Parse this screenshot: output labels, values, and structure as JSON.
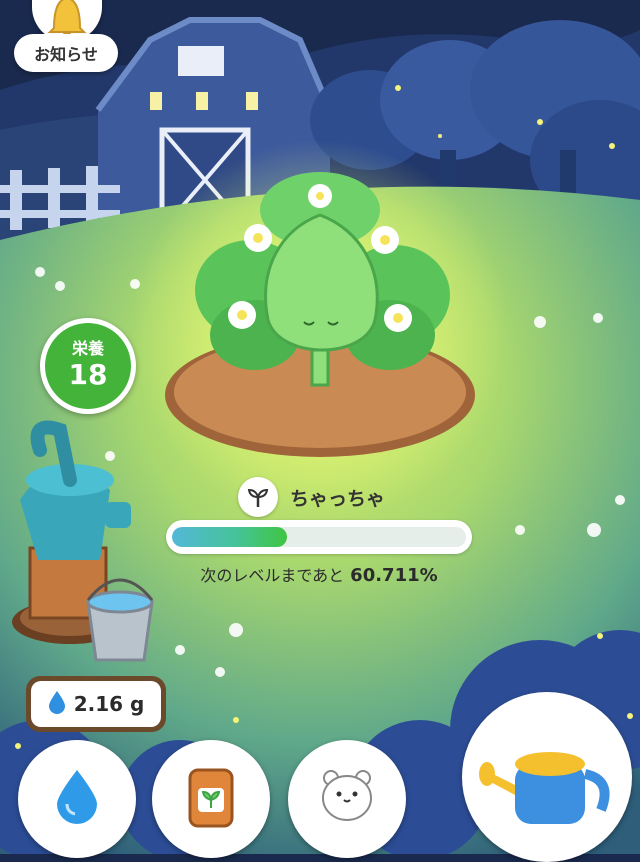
{
  "header": {
    "notice_label": "お知らせ",
    "bell_icon": "bell-icon"
  },
  "nutrition": {
    "label": "栄養",
    "value": "18",
    "color": "#43b33a"
  },
  "plant": {
    "name": "ちゃっちゃ",
    "icon": "sprout-icon"
  },
  "level": {
    "prefix": "次のレベルまであと",
    "percent_text": "60.711%",
    "progress": 0.39
  },
  "water": {
    "amount": "2.16 g",
    "icon": "water-drop-icon"
  },
  "bottom_bar": {
    "buttons": [
      {
        "name": "water-button",
        "icon": "water-drop-icon"
      },
      {
        "name": "fertilizer-button",
        "icon": "fertilizer-bag-icon"
      },
      {
        "name": "hamster-button",
        "icon": "hamster-icon"
      },
      {
        "name": "watering-can-button",
        "icon": "watering-can-icon"
      }
    ]
  },
  "colors": {
    "accent_green": "#43b33a",
    "progress_blue": "#53b8d8",
    "sky": "#1a2a4e",
    "grass": "#9fd36a"
  }
}
